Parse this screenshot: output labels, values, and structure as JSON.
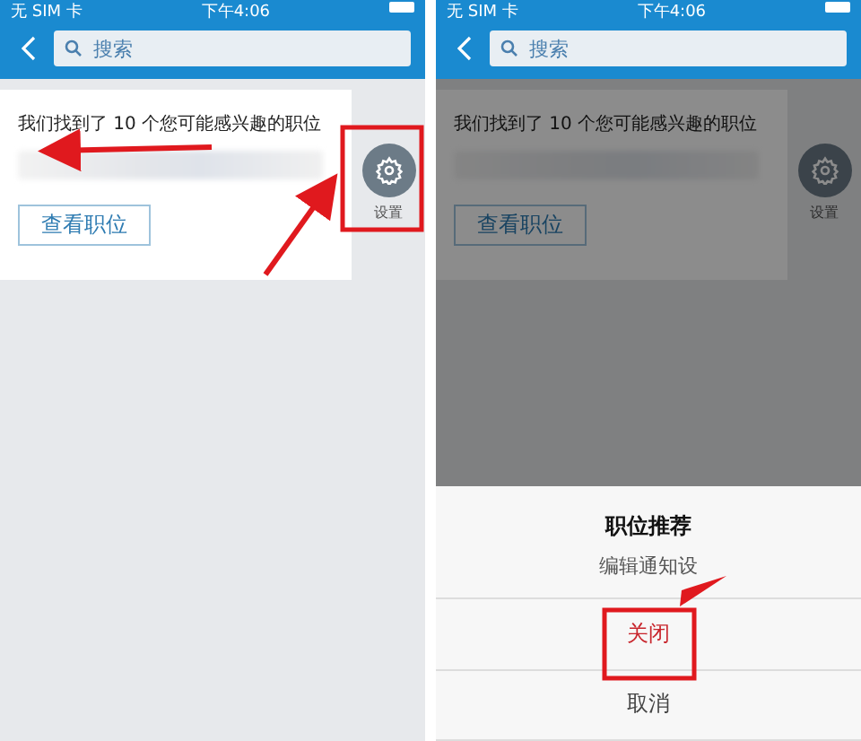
{
  "screens": [
    {
      "status": {
        "carrier": "无 SIM 卡",
        "time": "下午4:06"
      },
      "search": {
        "placeholder": "搜索"
      },
      "card": {
        "message": "我们找到了 10 个您可能感兴趣的职位",
        "button": "查看职位"
      },
      "side_button": {
        "label": "设置"
      },
      "dimmed": false
    },
    {
      "status": {
        "carrier": "无 SIM 卡",
        "time": "下午4:06"
      },
      "search": {
        "placeholder": "搜索"
      },
      "card": {
        "message": "我们找到了 10 个您可能感兴趣的职位",
        "button": "查看职位"
      },
      "side_button": {
        "label": "设置"
      },
      "dimmed": true
    }
  ],
  "action_sheet": {
    "title": "职位推荐",
    "subtitle": "编辑通知设",
    "options": [
      {
        "label": "关闭",
        "kind": "destructive"
      },
      {
        "label": "取消",
        "kind": "cancel"
      }
    ]
  }
}
